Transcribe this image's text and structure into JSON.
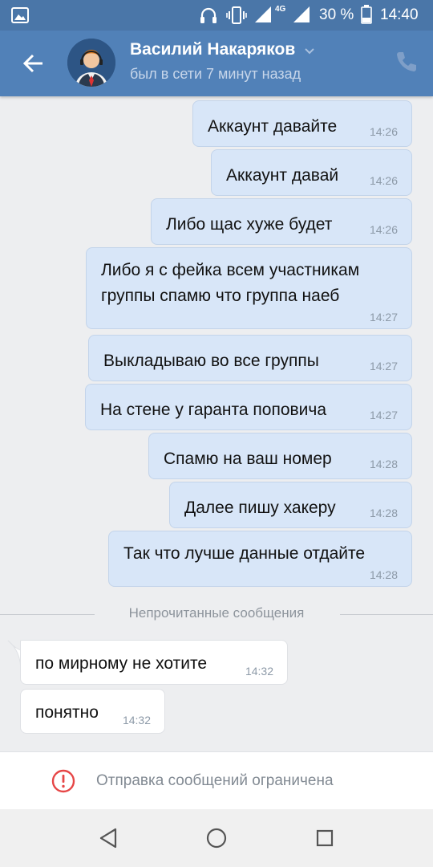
{
  "status_bar": {
    "battery_text": "30 %",
    "time": "14:40",
    "network_label": "4G"
  },
  "header": {
    "contact_name": "Василий Накаряков",
    "last_seen": "был в сети 7 минут назад"
  },
  "messages": [
    {
      "dir": "out",
      "text": "Аккаунт давайте",
      "time": "14:26"
    },
    {
      "dir": "out",
      "text": "Аккаунт давай",
      "time": "14:26"
    },
    {
      "dir": "out",
      "text": "Либо щас хуже будет",
      "time": "14:26"
    },
    {
      "dir": "out",
      "text": "Либо я с фейка всем участникам",
      "text2": "группы спамю что группа наеб",
      "time": "14:27"
    },
    {
      "dir": "out",
      "text": "Выкладываю во все группы",
      "time": "14:27"
    },
    {
      "dir": "out",
      "text": "На стене у гаранта поповича",
      "time": "14:27"
    },
    {
      "dir": "out",
      "text": "Спамю на ваш номер",
      "time": "14:28"
    },
    {
      "dir": "out",
      "text": "Далее пишу хакеру",
      "time": "14:28"
    },
    {
      "dir": "out",
      "text": "Так что лучше данные отдайте",
      "time": "14:28"
    },
    {
      "dir": "in",
      "text": "по мирному не хотите",
      "time": "14:32"
    },
    {
      "dir": "in",
      "text": "понятно",
      "time": "14:32"
    }
  ],
  "unread_divider": "Непрочитанные сообщения",
  "restricted_notice": "Отправка сообщений ограничена",
  "colors": {
    "header": "#5181b8",
    "status_bar": "#4a76a8",
    "outgoing_bubble": "#d8e6f8",
    "incoming_bubble": "#ffffff",
    "warning": "#e64646"
  },
  "icons": [
    "gallery-icon",
    "headphones-icon",
    "vibrate-icon",
    "signal-icon",
    "battery-icon",
    "back-arrow-icon",
    "chevron-down-icon",
    "phone-icon",
    "warning-icon",
    "nav-back-icon",
    "nav-home-icon",
    "nav-recents-icon"
  ]
}
